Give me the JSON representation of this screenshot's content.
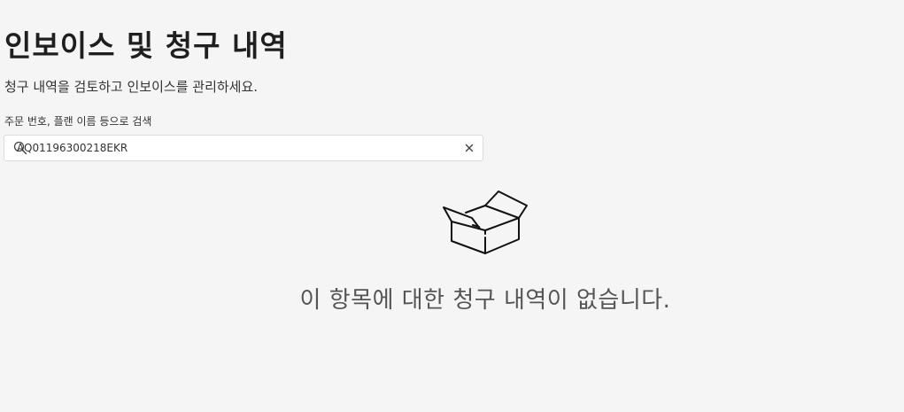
{
  "header": {
    "title": "인보이스 및 청구 내역",
    "subtitle": "청구 내역을 검토하고 인보이스를 관리하세요."
  },
  "search": {
    "label": "주문 번호, 플랜 이름 등으로 검색",
    "value": "AQ01196300218EKR",
    "icon": "search-icon",
    "clear_icon": "close-icon"
  },
  "empty_state": {
    "icon": "open-box-icon",
    "message": "이 항목에 대한 청구 내역이 없습니다."
  }
}
